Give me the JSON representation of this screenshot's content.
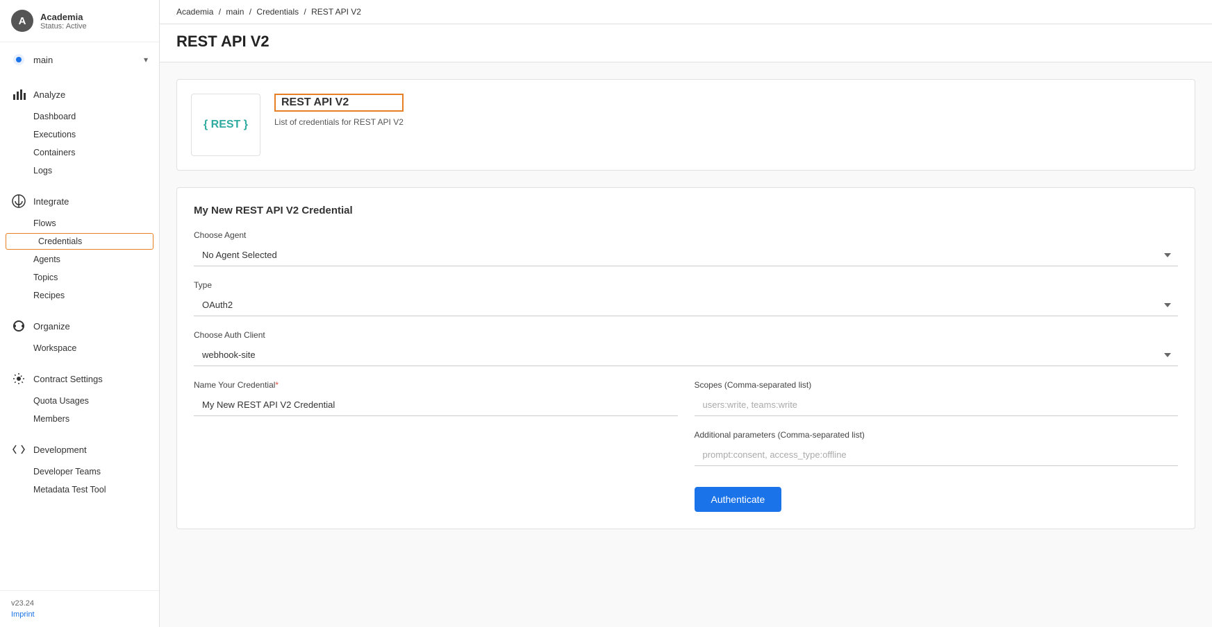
{
  "org": {
    "avatar": "A",
    "name": "Academia",
    "status": "Status: Active"
  },
  "sidebar": {
    "main_item": "main",
    "sections": [
      {
        "id": "analyze",
        "label": "Analyze",
        "icon": "bar-chart-icon",
        "subitems": [
          "Dashboard",
          "Executions",
          "Containers",
          "Logs"
        ]
      },
      {
        "id": "integrate",
        "label": "Integrate",
        "icon": "integrate-icon",
        "subitems": [
          "Flows",
          "Credentials",
          "Agents",
          "Topics",
          "Recipes"
        ]
      },
      {
        "id": "organize",
        "label": "Organize",
        "icon": "organize-icon",
        "subitems": [
          "Workspace"
        ]
      },
      {
        "id": "contract-settings",
        "label": "Contract Settings",
        "icon": "settings-icon",
        "subitems": [
          "Quota Usages",
          "Members"
        ]
      },
      {
        "id": "development",
        "label": "Development",
        "icon": "dev-icon",
        "subitems": [
          "Developer Teams",
          "Metadata Test Tool"
        ]
      }
    ],
    "active_subitem": "Credentials",
    "version": "v23.24",
    "imprint_label": "Imprint"
  },
  "breadcrumb": {
    "items": [
      "Academia",
      "main",
      "Credentials",
      "REST API V2"
    ],
    "separators": "/"
  },
  "page": {
    "title": "REST API V2"
  },
  "credential_card": {
    "logo_text": "{ REST }",
    "title": "REST API V2",
    "description": "List of credentials for REST API V2"
  },
  "form": {
    "section_title": "My New REST API V2 Credential",
    "choose_agent_label": "Choose Agent",
    "choose_agent_value": "No Agent Selected",
    "type_label": "Type",
    "type_value": "OAuth2",
    "choose_auth_client_label": "Choose Auth Client",
    "choose_auth_client_value": "webhook-site",
    "name_credential_label": "Name Your Credential",
    "name_credential_required": "*",
    "name_credential_value": "My New REST API V2 Credential",
    "scopes_label": "Scopes (Comma-separated list)",
    "scopes_placeholder": "users:write, teams:write",
    "additional_params_label": "Additional parameters (Comma-separated list)",
    "additional_params_placeholder": "prompt:consent, access_type:offline",
    "authenticate_button": "Authenticate"
  }
}
